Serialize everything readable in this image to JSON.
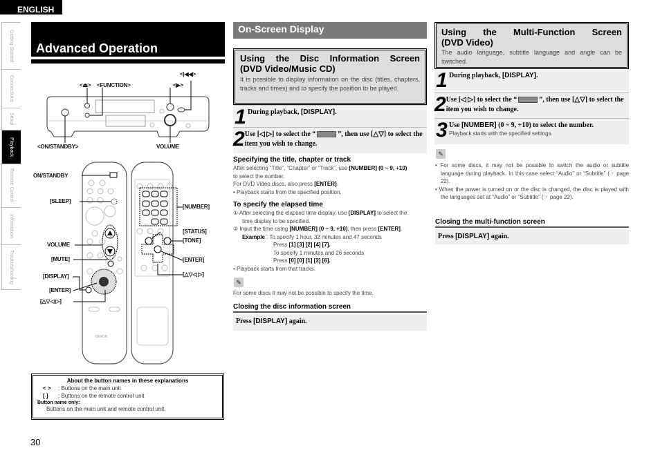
{
  "language_tab": "ENGLISH",
  "side_tabs": [
    {
      "label": "Getting Started",
      "active": false
    },
    {
      "label": "Connections",
      "active": false
    },
    {
      "label": "Setup",
      "active": false
    },
    {
      "label": "Playback",
      "active": true
    },
    {
      "label": "Remote Control",
      "active": false
    },
    {
      "label": "Information",
      "active": false
    },
    {
      "label": "Troubleshooting",
      "active": false
    }
  ],
  "page_title": "Advanced Operation",
  "main_unit_labels": {
    "eject": "<⏏>",
    "function": "<FUNCTION>",
    "play": "<▶>",
    "skip_back": "<|◀◀>",
    "on_standby": "<ON/STANDBY>",
    "volume": "VOLUME"
  },
  "remote_labels": {
    "on_standby": "ON/STANDBY",
    "sleep": "[SLEEP]",
    "volume": "VOLUME",
    "mute": "[MUTE]",
    "display": "[DISPLAY]",
    "enter_left": "[ENTER]",
    "cursor_left": "[△▽◁ ▷]",
    "number": "[NUMBER]",
    "status": "[STATUS]",
    "tone": "[TONE]",
    "enter_right": "[ENTER]",
    "cursor_right": "[△▽◁ ▷]",
    "brand": "DENON"
  },
  "legend": {
    "header": "About the button names in these explanations",
    "rows": [
      {
        "symbol": "<   >",
        "text": ": Buttons on the main unit"
      },
      {
        "symbol": "[    ]",
        "text": ": Buttons on the remote control unit"
      }
    ],
    "only_label": "Button name only:",
    "only_desc": "Buttons on the main unit and remote control unit"
  },
  "page_number": "30",
  "section_title": "On-Screen Display",
  "disc_info": {
    "title_line1": "Using the Disc Information Screen",
    "title_line2": "(DVD Video/Music CD)",
    "desc": "It is possible to display information on the disc (titles, chapters, tracks and times) and to specify the position to be played.",
    "steps": [
      {
        "num": "1",
        "pre": "During playback, ",
        "key": "[DISPLAY]",
        "post": "."
      },
      {
        "num": "2",
        "pre": "Use [◁ ▷] to select the “",
        "post": "”, then use [△▽] to select the item you wish to change."
      }
    ],
    "sub1_title": "Specifying the title, chapter or track",
    "sub1_l1a": "After selecting “Title”, “Chapter” or “Track”, use ",
    "sub1_l1b": "[NUMBER] (0 ~ 9, +10)",
    "sub1_l2": "to select the number.",
    "sub1_l3a": "For DVD Video discs, also press ",
    "sub1_l3b": "[ENTER]",
    "sub1_l4": "• Playback starts from the specified position.",
    "sub2_title": "To specify the elapsed time",
    "sub2_l1a": "① After selecting the elapsed time display, use ",
    "sub2_l1b": "[DISPLAY]",
    "sub2_l1c": " to select the",
    "sub2_l2": "time display to be specified.",
    "sub2_l3a": "② Input the time using ",
    "sub2_l3b": "[NUMBER] (0 ~ 9, +10)",
    "sub2_l3c": ", then press ",
    "sub2_l3d": "[ENTER]",
    "example_label": "Example",
    "example_1": ": To specify 1 hour, 32 minutes and 47 seconds",
    "example_1_press": "Press ",
    "example_1_keys": "[1] [3] [2] [4] [7].",
    "example_2": "To specify 1 minutes and 26 seconds",
    "example_2_press": "Press ",
    "example_2_keys": "[0] [0] [1] [2] [6].",
    "sub2_last": "• Playback starts from that tracks.",
    "note": "For some discs it may not be possible to specify the time.",
    "close_title": "Closing the disc information screen",
    "close_pre": "Press ",
    "close_key": "[DISPLAY]",
    "close_post": " again."
  },
  "multi_func": {
    "title_line1": "Using the Multi-Function Screen",
    "title_line2": "(DVD Video)",
    "desc": "The audio language, subtitle language and angle can be switched.",
    "step1_pre": "During playback, ",
    "step1_key": "[DISPLAY]",
    "step1_post": ".",
    "step2_pre": "Use [◁ ▷] to select the “",
    "step2_post": "”, then use [△▽] to select the item you wish to change.",
    "step3_pre": "Use ",
    "step3_key": "[NUMBER]",
    "step3_post": " (0 ~ 9, +10) to select the number.",
    "step3_sub": "Playback starts with the specified settings.",
    "notes": [
      "For some discs, it may not be possible to switch the audio or subtitle language during playback. In this case select “Audio” or “Subtitle” (☞ page 22).",
      "When the power is turned on or the disc is changed, the disc is played with the languages set at “Audio” or “Subtitle” (☞ page 22)."
    ],
    "close_title": "Closing the multi-function screen",
    "close_pre": "Press ",
    "close_key": "[DISPLAY]",
    "close_post": " again."
  }
}
